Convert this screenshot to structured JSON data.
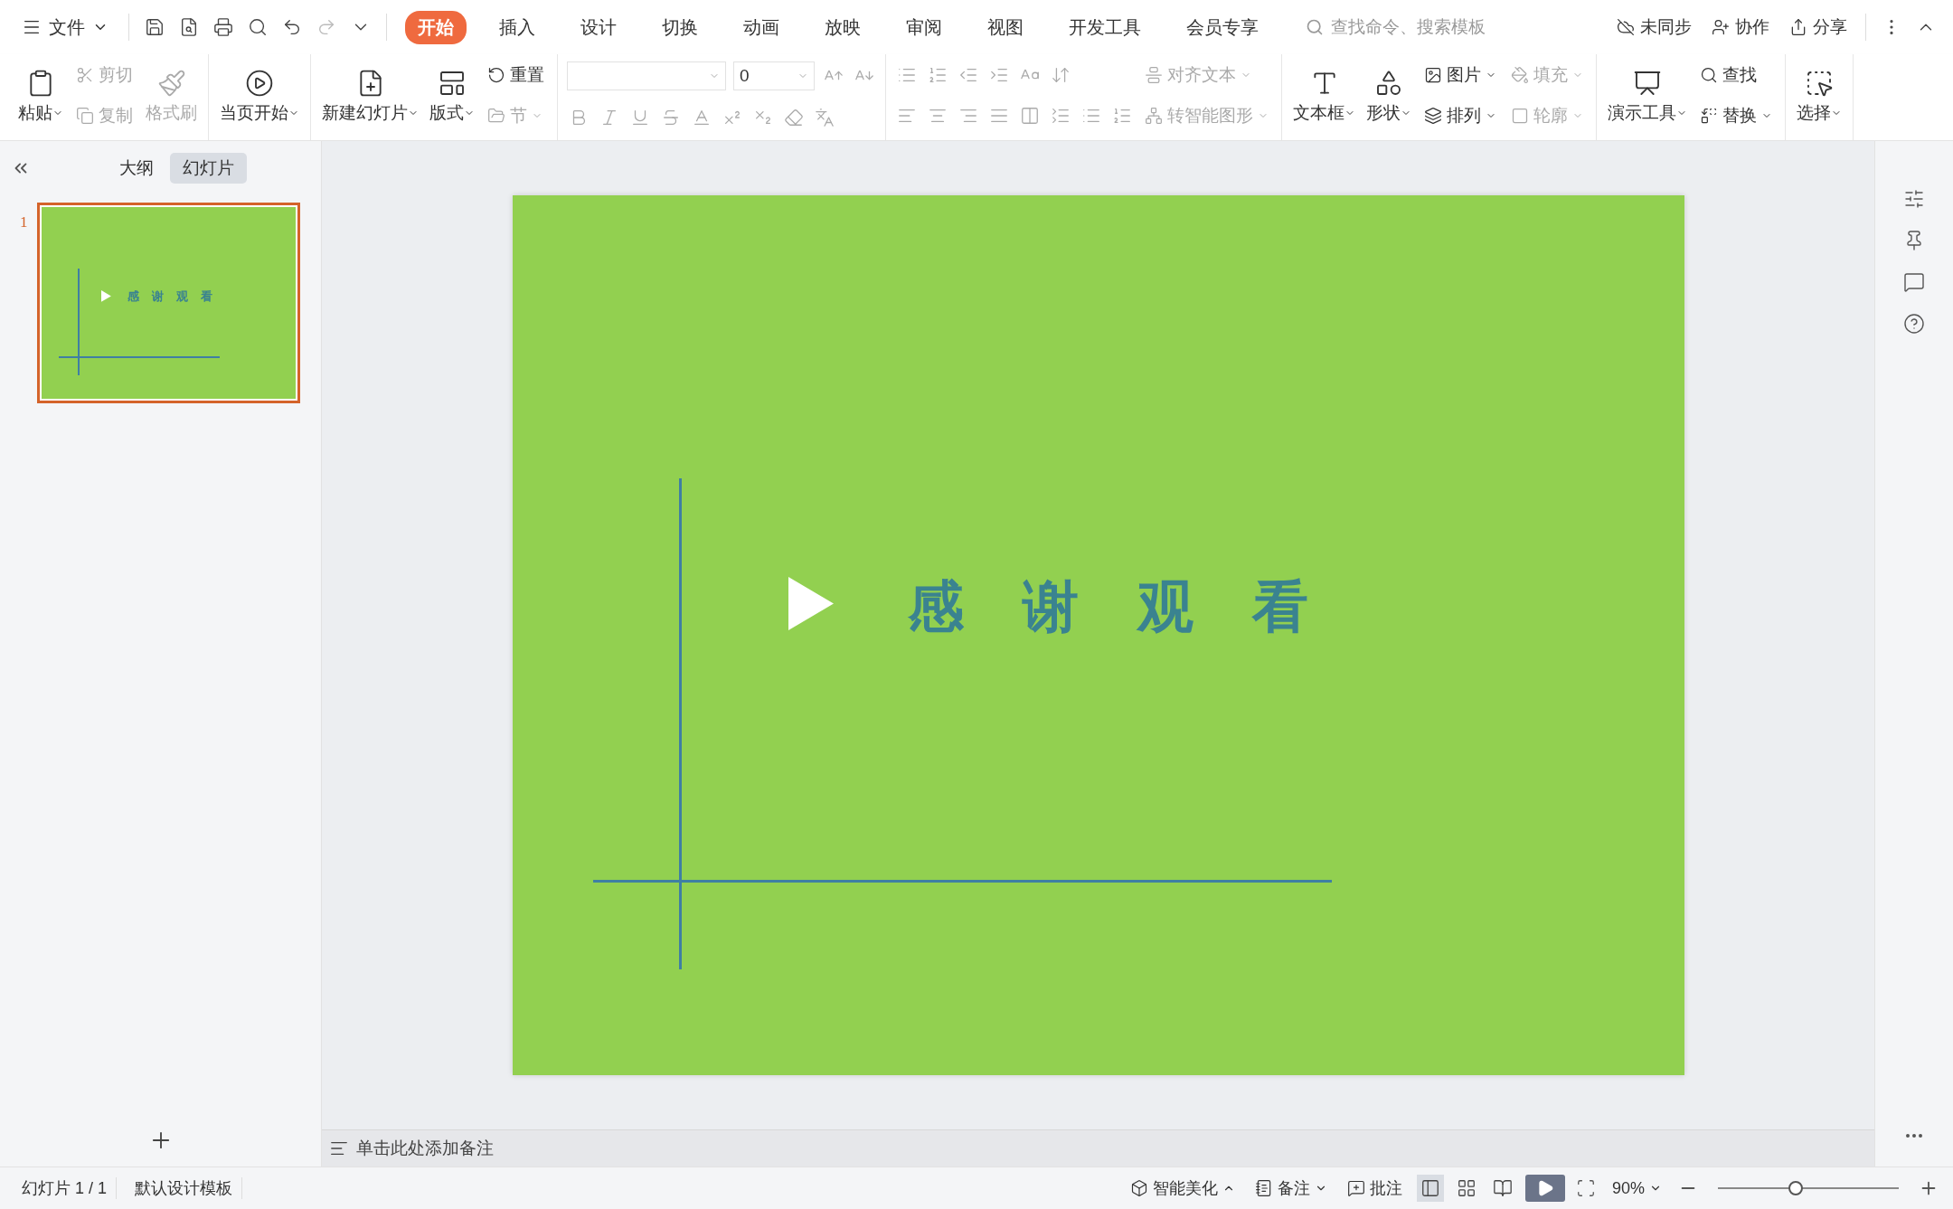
{
  "menu": {
    "label": "文件"
  },
  "tabs": [
    {
      "label": "开始",
      "selected": true
    },
    {
      "label": "插入",
      "selected": false
    },
    {
      "label": "设计",
      "selected": false
    },
    {
      "label": "切换",
      "selected": false
    },
    {
      "label": "动画",
      "selected": false
    },
    {
      "label": "放映",
      "selected": false
    },
    {
      "label": "审阅",
      "selected": false
    },
    {
      "label": "视图",
      "selected": false
    },
    {
      "label": "开发工具",
      "selected": false
    },
    {
      "label": "会员专享",
      "selected": false
    }
  ],
  "search": {
    "placeholder": "查找命令、搜索模板"
  },
  "top_actions": [
    "未同步",
    "协作",
    "分享"
  ],
  "ribbon": [
    {
      "columns": [
        [
          {
            "label": "粘贴",
            "kind": "large",
            "disabled": false,
            "dropdown": true
          }
        ],
        [
          {
            "label": "剪切",
            "kind": "small",
            "disabled": true,
            "dropdown": false
          },
          {
            "label": "复制",
            "kind": "small",
            "disabled": true,
            "dropdown": false
          }
        ],
        [
          {
            "label": "格式刷",
            "kind": "large",
            "disabled": true,
            "dropdown": false
          }
        ]
      ]
    },
    {
      "columns": [
        [
          {
            "label": "当页开始",
            "kind": "large",
            "disabled": false,
            "dropdown": true
          }
        ]
      ]
    },
    {
      "columns": [
        [
          {
            "label": "新建幻灯片",
            "kind": "large",
            "disabled": false,
            "dropdown": true
          }
        ],
        [
          {
            "label": "版式",
            "kind": "large",
            "disabled": false,
            "dropdown": true
          }
        ],
        [
          {
            "label": "重置",
            "kind": "small",
            "disabled": false,
            "dropdown": false
          },
          {
            "label": "节",
            "kind": "small",
            "disabled": true,
            "dropdown": true
          }
        ]
      ]
    },
    {
      "columns": [
        [
          {
            "label": "对齐文本",
            "kind": "small",
            "disabled": true,
            "dropdown": true
          },
          {
            "label": "转智能图形",
            "kind": "small",
            "disabled": true,
            "dropdown": true
          }
        ]
      ]
    },
    {
      "columns": [
        [
          {
            "label": "文本框",
            "kind": "large",
            "disabled": false,
            "dropdown": true
          }
        ],
        [
          {
            "label": "形状",
            "kind": "large",
            "disabled": false,
            "dropdown": true
          }
        ],
        [
          {
            "label": "图片",
            "kind": "small",
            "disabled": false,
            "dropdown": true
          },
          {
            "label": "排列",
            "kind": "small",
            "disabled": false,
            "dropdown": true
          }
        ],
        [
          {
            "label": "填充",
            "kind": "small",
            "disabled": true,
            "dropdown": true
          },
          {
            "label": "轮廓",
            "kind": "small",
            "disabled": true,
            "dropdown": true
          }
        ]
      ]
    },
    {
      "columns": [
        [
          {
            "label": "演示工具",
            "kind": "large",
            "disabled": false,
            "dropdown": true
          }
        ],
        [
          {
            "label": "查找",
            "kind": "small",
            "disabled": false,
            "dropdown": false
          },
          {
            "label": "替换",
            "kind": "small",
            "disabled": false,
            "dropdown": true
          }
        ]
      ]
    },
    {
      "columns": [
        [
          {
            "label": "选择",
            "kind": "large",
            "disabled": false,
            "dropdown": true
          }
        ]
      ]
    }
  ],
  "font": {
    "size": "0"
  },
  "view_tabs": [
    {
      "label": "大纲",
      "selected": false
    },
    {
      "label": "幻灯片",
      "selected": true
    }
  ],
  "thumbnails": [
    {
      "number": "1",
      "selected": true,
      "title": "感谢观看"
    }
  ],
  "slide": {
    "title": "感谢观看"
  },
  "notes": {
    "placeholder": "单击此处添加备注"
  },
  "status_bar": {
    "slide_count": "幻灯片 1 / 1",
    "template": "默认设计模板",
    "beautify": "智能美化",
    "notes": "备注",
    "comments": "批注",
    "views": [
      {
        "selected": true
      },
      {
        "selected": false
      },
      {
        "selected": false
      }
    ],
    "zoom": "90%",
    "zoom_slider": {
      "level": 0.43
    }
  }
}
